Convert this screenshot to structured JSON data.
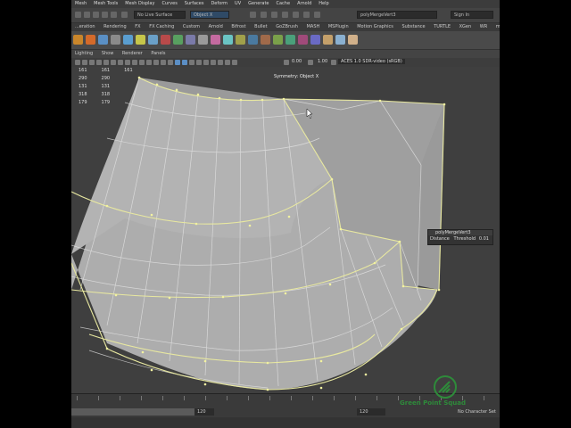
{
  "menubar": [
    "Mesh",
    "Mesh Tools",
    "Mesh Display",
    "Curves",
    "Surfaces",
    "Deform",
    "UV",
    "Generate",
    "Cache",
    "Arnold",
    "Help"
  ],
  "status": {
    "live_surface": "No Live Surface",
    "object_mode": "Object X",
    "node_field": "polyMergeVert3",
    "sign_in": "Sign In"
  },
  "shelf_tabs": [
    "...eration",
    "Rendering",
    "FX",
    "FX Caching",
    "Custom",
    "Arnold",
    "Bifrost",
    "Bullet",
    "GoZBrush",
    "MASH",
    "MSPlugin",
    "Motion Graphics",
    "Substance",
    "TURTLE",
    "XGen",
    "WR",
    "makcom"
  ],
  "panel_menu": [
    "Lighting",
    "Show",
    "Renderer",
    "Panels"
  ],
  "panel_toolbar": {
    "exposure": "0.00",
    "gamma": "1.00",
    "color_space": "ACES 1.0 SDR-video (sRGB)"
  },
  "hud_rows": [
    [
      "161",
      "161",
      "161"
    ],
    [
      "290",
      "290",
      ""
    ],
    [
      "131",
      "131",
      ""
    ],
    [
      "318",
      "318",
      ""
    ],
    [
      "179",
      "179",
      ""
    ]
  ],
  "viewport": {
    "symmetry_label": "Symmetry: Object X"
  },
  "merge_popup": {
    "title": "polyMergeVert3",
    "param_label": "Distance",
    "param_name": "Threshold",
    "value": "0.01"
  },
  "timeline": {
    "start": "120",
    "end": "120",
    "no_char_set": "No Character Set"
  },
  "logo": {
    "text": "Green Point Squad"
  },
  "colors": {
    "wire_selected": "#e8e8a0",
    "surface": "#a8a8a8",
    "logo_green": "#2e8b3a"
  }
}
